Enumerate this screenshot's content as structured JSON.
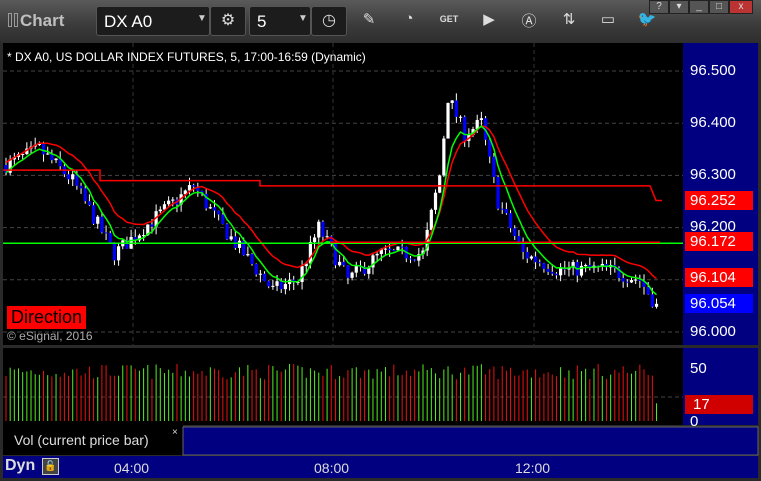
{
  "window": {
    "title": "Chart",
    "help": "?",
    "minimize": "_",
    "maximize": "□",
    "close": "x"
  },
  "toolbar": {
    "symbol": "DX A0",
    "interval": "5"
  },
  "chart": {
    "header": "* DX A0, US DOLLAR INDEX FUTURES, 5, 17:00-16:59 (Dynamic)",
    "price_ticks": [
      "96.500",
      "96.400",
      "96.300",
      "96.200",
      "96.000"
    ],
    "price_tags": [
      {
        "value": "96.252",
        "color": "#ff0000"
      },
      {
        "value": "96.172",
        "color": "#ff0000"
      },
      {
        "value": "96.104",
        "color": "#ff0000"
      },
      {
        "value": "96.054",
        "color": "#0000ff"
      }
    ],
    "direction_label": "Direction",
    "copyright": "© eSignal, 2016",
    "volume": {
      "label": "Vol (current price bar)",
      "close": "×",
      "tick": "50",
      "zero": "0",
      "current": "17"
    },
    "time_ticks": [
      "04:00",
      "08:00",
      "12:00"
    ],
    "mode": "Dyn"
  },
  "chart_data": {
    "type": "candlestick",
    "title": "DX A0, US DOLLAR INDEX FUTURES, 5",
    "ylim": [
      95.99,
      96.53
    ],
    "path_waypoints": [
      [
        0,
        96.32
      ],
      [
        8,
        96.35
      ],
      [
        16,
        96.29
      ],
      [
        26,
        96.15
      ],
      [
        36,
        96.22
      ],
      [
        45,
        96.28
      ],
      [
        52,
        96.2
      ],
      [
        64,
        96.08
      ],
      [
        70,
        96.1
      ],
      [
        75,
        96.2
      ],
      [
        82,
        96.1
      ],
      [
        90,
        96.15
      ],
      [
        100,
        96.15
      ],
      [
        104,
        96.3
      ],
      [
        106,
        96.45
      ],
      [
        110,
        96.38
      ],
      [
        114,
        96.4
      ],
      [
        118,
        96.25
      ],
      [
        124,
        96.15
      ],
      [
        132,
        96.12
      ],
      [
        144,
        96.12
      ],
      [
        152,
        96.1
      ],
      [
        156,
        96.05
      ]
    ],
    "support_level": 96.172,
    "resistance_level": 96.172,
    "last": 96.054,
    "last_volume": 17
  },
  "colors": {
    "axis_bg": "#000080",
    "up": "#ffffff",
    "down": "#0000ff",
    "ma_fast": "#00ff00",
    "ma_slow": "#ff0000"
  }
}
